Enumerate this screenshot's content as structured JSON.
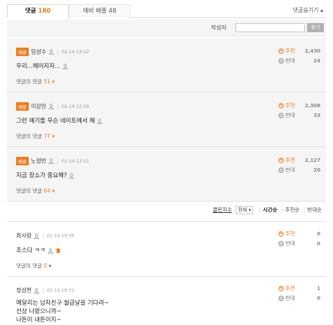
{
  "tabs": [
    {
      "label": "댓글",
      "count": "180"
    },
    {
      "label": "에비 베플",
      "count": "48"
    }
  ],
  "toggle_label": "댓글숨기기 ▴",
  "search": {
    "label": "작성자",
    "button": "찾기"
  },
  "best_badge": "베플",
  "vote_up_label": "추천",
  "vote_down_label": "반대",
  "reply_prefix": "댓글의 댓글",
  "best_comments": [
    {
      "author": "임성수",
      "time": "02.14 12:22",
      "text": "우리...헤어지자...",
      "replies": "51",
      "up": "2,430",
      "down": "24"
    },
    {
      "author": "이강민",
      "time": "02.14 12:28",
      "text": "그런 얘기를 무슨 네이트에서 해",
      "replies": "77",
      "up": "2,308",
      "down": "33"
    },
    {
      "author": "노정빈",
      "time": "02.14 12:51",
      "text": "지금 장소가 중요해?",
      "replies": "64",
      "up": "2,127",
      "down": "20"
    }
  ],
  "sort": {
    "filter_link": "클린지수",
    "filter_value": "전체",
    "option1": "시간순",
    "option2": "추천순",
    "option3": "반대순"
  },
  "comments": [
    {
      "author": "최사랑",
      "time": "02.14 19:36",
      "text": "조스다 ㅋㅋ",
      "replies": "0",
      "up": "0",
      "down": "0"
    },
    {
      "author": "정성현",
      "time": "02.14 19:31",
      "lines": [
        "매달리는 남자친구 월급날을 기다려~",
        "선상 나왔으니까~",
        "나돈이 내돈이지~"
      ],
      "up": "1",
      "down": "0"
    }
  ]
}
